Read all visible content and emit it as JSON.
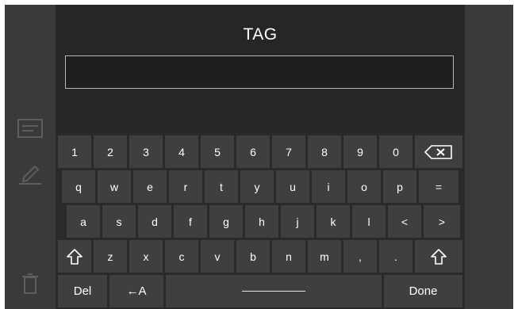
{
  "title": "TAG",
  "input": {
    "value": ""
  },
  "sidebar": {
    "icons": [
      "note-icon",
      "pencil-icon",
      "trash-icon"
    ]
  },
  "keyboard": {
    "row1": [
      "1",
      "2",
      "3",
      "4",
      "5",
      "6",
      "7",
      "8",
      "9",
      "0"
    ],
    "row2": [
      "q",
      "w",
      "e",
      "r",
      "t",
      "y",
      "u",
      "i",
      "o",
      "p",
      "="
    ],
    "row3": [
      "a",
      "s",
      "d",
      "f",
      "g",
      "h",
      "j",
      "k",
      "l",
      "<",
      ">"
    ],
    "row4": [
      "z",
      "x",
      "c",
      "v",
      "b",
      "n",
      "m",
      ",",
      "."
    ],
    "del_label": "Del",
    "case_label": "←A",
    "done_label": "Done"
  }
}
